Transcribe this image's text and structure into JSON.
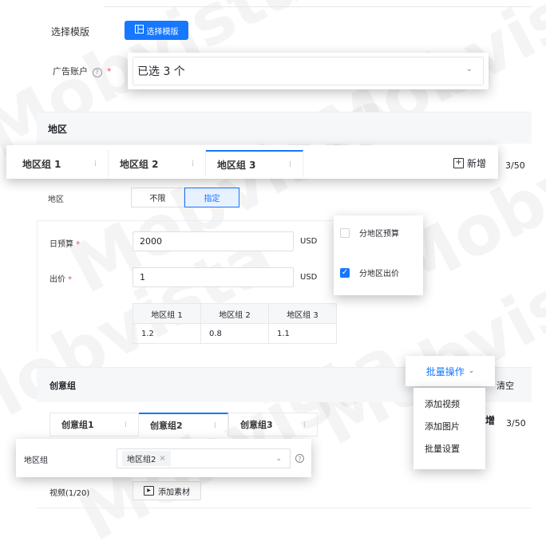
{
  "template": {
    "label": "选择模版",
    "button": "选择模版"
  },
  "ad_account": {
    "label": "广告账户",
    "required": "*",
    "value": "已选 3 个"
  },
  "region_section": {
    "title": "地区",
    "tabs": [
      "地区组 1",
      "地区组 2",
      "地区组 3"
    ],
    "add_label": "新增",
    "count": "3/50",
    "region_label": "地区",
    "toggle": [
      "不限",
      "指定"
    ]
  },
  "budget": {
    "daily_label": "日预算",
    "daily_value": "2000",
    "daily_unit": "USD",
    "bid_label": "出价",
    "bid_value": "1",
    "bid_unit": "USD",
    "required": "*",
    "table_headers": [
      "地区组 1",
      "地区组 2",
      "地区组 3"
    ],
    "table_values": [
      "1.2",
      "0.8",
      "1.1"
    ]
  },
  "split_popup": {
    "opt1": "分地区预算",
    "opt2": "分地区出价",
    "opt2_checked": "✓"
  },
  "creative_section": {
    "title": "创意组",
    "tabs": [
      "创意组1",
      "创意组2",
      "创意组3"
    ],
    "clear": "清空",
    "count": "3/50",
    "partial": "增"
  },
  "batch": {
    "label": "批量操作",
    "items": [
      "添加视频",
      "添加图片",
      "批量设置"
    ]
  },
  "region_group": {
    "label": "地区组",
    "tag": "地区组2",
    "tag_close": "×"
  },
  "video": {
    "label": "视频(1/20)",
    "button": "添加素材"
  },
  "watermark": "Mobvista",
  "colors": {
    "primary": "#1677ff",
    "required": "#e34d59"
  }
}
